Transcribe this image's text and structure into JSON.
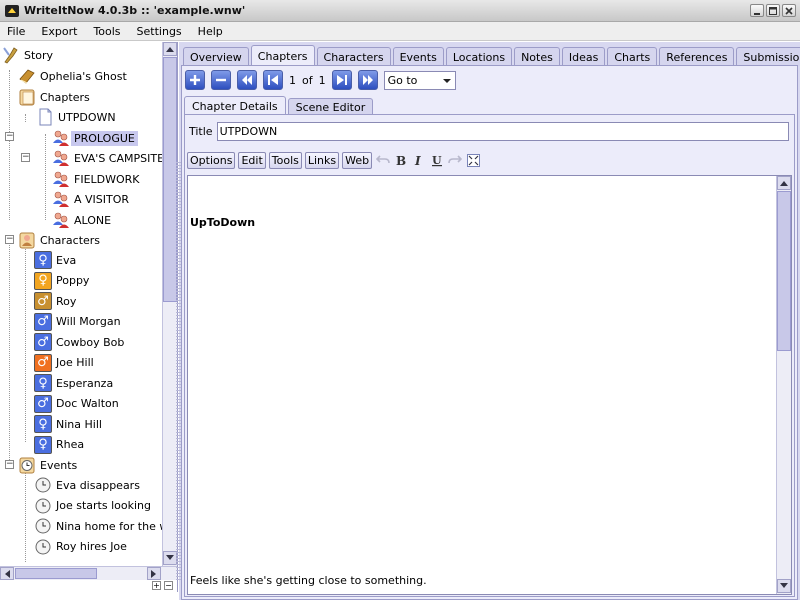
{
  "window": {
    "title": "WriteItNow 4.0.3b :: 'example.wnw'"
  },
  "menu": [
    "File",
    "Export",
    "Tools",
    "Settings",
    "Help"
  ],
  "tree": {
    "root": "Story",
    "ghost": "Ophelia's Ghost",
    "chapters_label": "Chapters",
    "chapter_name": "UTPDOWN",
    "scenes": [
      "PROLOGUE",
      "EVA'S CAMPSITE",
      "FIELDWORK",
      "A VISITOR",
      "ALONE"
    ],
    "characters_label": "Characters",
    "characters": [
      {
        "name": "Eva",
        "gender": "female",
        "bg": "#4a6ee0"
      },
      {
        "name": "Poppy",
        "gender": "female",
        "bg": "#f2a520"
      },
      {
        "name": "Roy",
        "gender": "male",
        "bg": "#c89030"
      },
      {
        "name": "Will Morgan",
        "gender": "male",
        "bg": "#4a6ee0"
      },
      {
        "name": "Cowboy Bob",
        "gender": "male",
        "bg": "#4a6ee0"
      },
      {
        "name": "Joe Hill",
        "gender": "male",
        "bg": "#f07020"
      },
      {
        "name": "Esperanza",
        "gender": "female",
        "bg": "#4a6ee0"
      },
      {
        "name": "Doc Walton",
        "gender": "male",
        "bg": "#4a6ee0"
      },
      {
        "name": "Nina Hill",
        "gender": "female",
        "bg": "#4a6ee0"
      },
      {
        "name": "Rhea",
        "gender": "female",
        "bg": "#4a6ee0"
      }
    ],
    "events_label": "Events",
    "events": [
      "Eva disappears",
      "Joe starts looking",
      "Nina home for the weekend",
      "Roy hires Joe"
    ]
  },
  "tabs": [
    "Overview",
    "Chapters",
    "Characters",
    "Events",
    "Locations",
    "Notes",
    "Ideas",
    "Charts",
    "References",
    "Submissions"
  ],
  "active_tab": "Chapters",
  "nav": {
    "page_current": "1",
    "page_of": "of",
    "page_total": "1",
    "goto_value": "Go to"
  },
  "subtabs": [
    "Chapter Details",
    "Scene Editor"
  ],
  "chapter": {
    "title_label": "Title",
    "title_value": "UTPDOWN"
  },
  "toolbar": [
    "Options",
    "Edit",
    "Tools",
    "Links",
    "Web"
  ],
  "editor": {
    "heading": "UpToDown",
    "body_fragment": "Feels like she's getting close to something."
  },
  "colors": {
    "accent": "#2e4fbf",
    "panel": "#d8d8f0",
    "selection": "#c8c8ee"
  }
}
